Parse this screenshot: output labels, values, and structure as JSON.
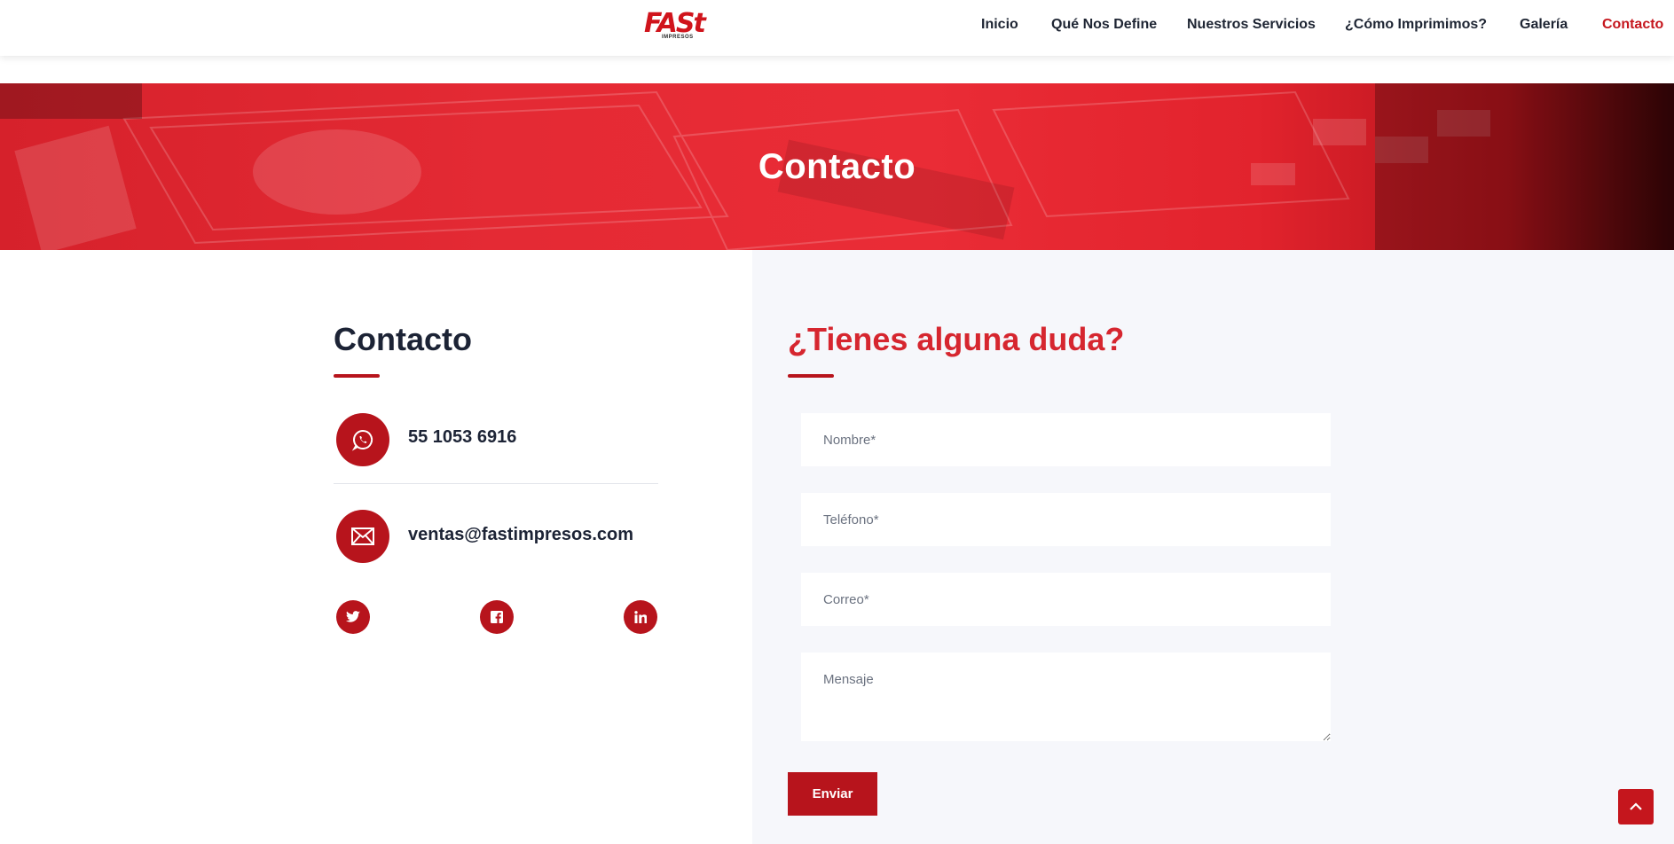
{
  "header": {
    "logo_text": "FASt",
    "logo_subtext": "IMPRESOS",
    "nav": [
      {
        "label": "Inicio",
        "active": false
      },
      {
        "label": "Qué Nos Define",
        "active": false
      },
      {
        "label": "Nuestros Servicios",
        "active": false
      },
      {
        "label": "¿Cómo Imprimimos?",
        "active": false
      },
      {
        "label": "Galería",
        "active": false
      },
      {
        "label": "Contacto",
        "active": true
      }
    ]
  },
  "hero": {
    "title": "Contacto"
  },
  "contact": {
    "title": "Contacto",
    "phone": "55 1053 6916",
    "email": "ventas@fastimpresos.com",
    "phone_icon": "whatsapp-icon",
    "email_icon": "envelope-icon",
    "social": [
      "twitter-icon",
      "facebook-icon",
      "linkedin-icon"
    ]
  },
  "form": {
    "title": "¿Tienes alguna duda?",
    "name_placeholder": "Nombre*",
    "phone_placeholder": "Teléfono*",
    "email_placeholder": "Correo*",
    "message_placeholder": "Mensaje",
    "submit_label": "Enviar"
  },
  "colors": {
    "brand_red": "#b7141c",
    "active_nav": "#c5161d",
    "heading_dark": "#1c2335",
    "form_title": "#d6262f",
    "panel_bg": "#f6f7fb"
  }
}
